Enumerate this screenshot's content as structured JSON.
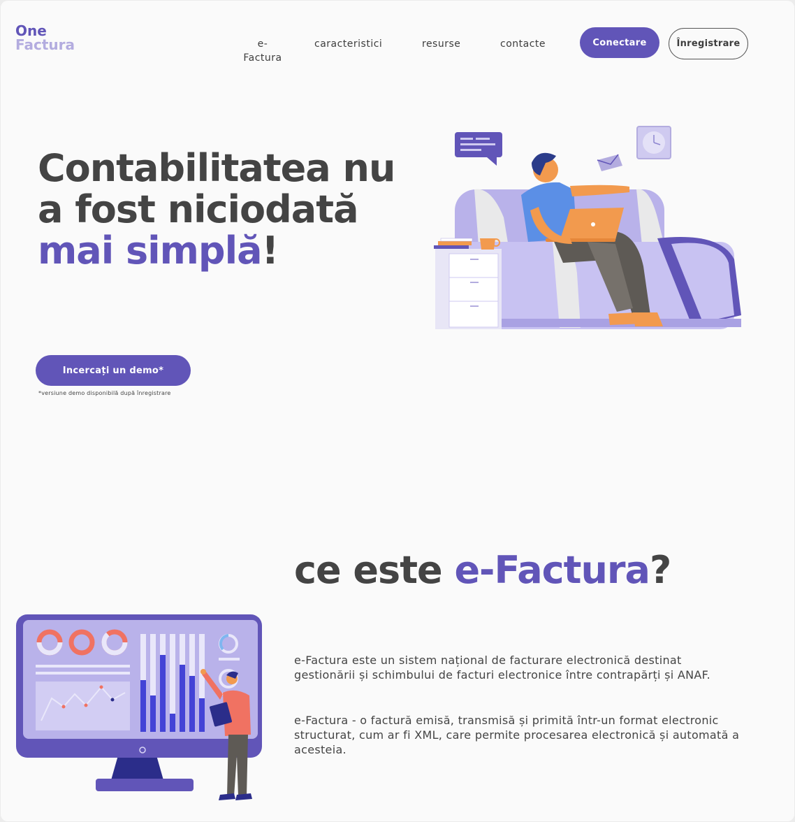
{
  "brand": {
    "line1": "One",
    "line2": "Factura"
  },
  "nav": {
    "efactura": "e-\nFactura",
    "caracteristici": "caracteristici",
    "resurse": "resurse",
    "contacte": "contacte",
    "login": "Conectare",
    "register": "Înregistrare"
  },
  "hero": {
    "title_part1": "Contabilitatea nu a fost niciodată ",
    "title_accent": "mai simplă",
    "title_end": "!",
    "demo_button": "Incercați un demo*",
    "demo_note": "*versiune demo disponibilă după înregistrare"
  },
  "section_efactura": {
    "title_part1": "ce este ",
    "title_accent": "e-Factura",
    "title_end": "?",
    "paragraph1": "e-Factura este un sistem național de facturare electronică destinat gestionării și schimbului de facturi electronice între contrapărți și ANAF.",
    "paragraph2": "e-Factura - o factură emisă, transmisă și primită într-un format electronic structurat, cum ar fi XML, care permite procesarea electronică și automată a acesteia."
  },
  "colors": {
    "accent": "#6155b8",
    "accent_light": "#b3acdf",
    "text": "#444444"
  },
  "icons": [
    "laptop-person-illustration",
    "chat-bubble-icon",
    "envelope-icon",
    "clock-icon",
    "dashboard-monitor-illustration"
  ]
}
